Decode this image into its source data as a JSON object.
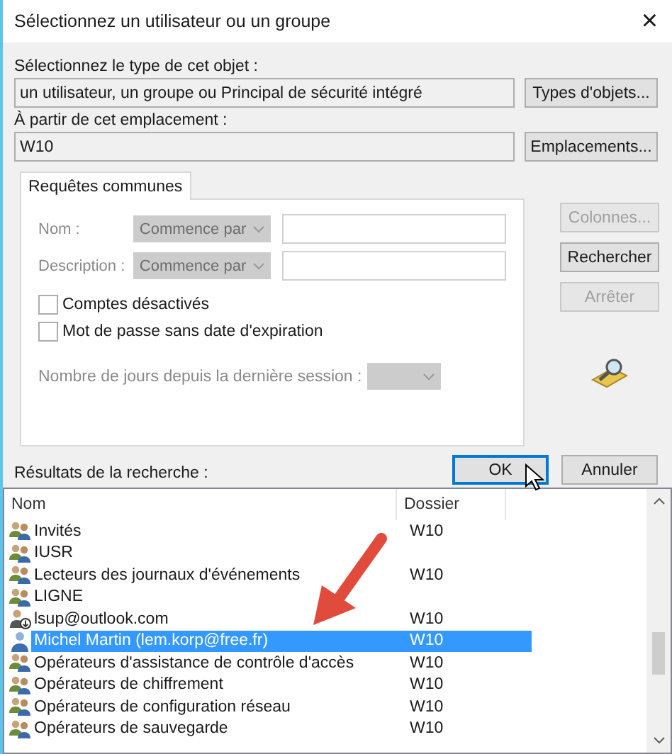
{
  "window": {
    "title": "Sélectionnez un utilisateur ou un groupe",
    "close": "×"
  },
  "object_type": {
    "label": "Sélectionnez le type de cet objet :",
    "value": "un utilisateur, un groupe ou Principal de sécurité intégré",
    "button": "Types d'objets..."
  },
  "location": {
    "label": "À partir de cet emplacement :",
    "value": "W10",
    "button": "Emplacements..."
  },
  "tabs": [
    {
      "label": "Requêtes communes",
      "selected": true
    }
  ],
  "query": {
    "fields": [
      {
        "label": "Nom :",
        "operator": "Commence par",
        "disabled": true
      },
      {
        "label": "Description :",
        "operator": "Commence par",
        "disabled": true
      }
    ],
    "checkboxes": [
      {
        "label": "Comptes désactivés",
        "checked": false
      },
      {
        "label": "Mot de passe sans date d'expiration",
        "checked": false
      }
    ],
    "days": {
      "label": "Nombre de jours depuis la dernière session :",
      "disabled": true
    }
  },
  "side_buttons": [
    {
      "label": "Colonnes...",
      "disabled": true
    },
    {
      "label": "Rechercher",
      "disabled": false
    },
    {
      "label": "Arrêter",
      "disabled": true
    }
  ],
  "dialog_buttons": [
    {
      "label": "OK",
      "default": true
    },
    {
      "label": "Annuler",
      "default": false
    }
  ],
  "results": {
    "label": "Résultats de la recherche :",
    "columns": [
      "Nom",
      "Dossier"
    ],
    "rows": [
      {
        "name": "Invités",
        "folder": "W10",
        "kind": "group",
        "selected": false
      },
      {
        "name": "IUSR",
        "kind": "group",
        "selected": false
      },
      {
        "name": "Lecteurs des journaux d'événements",
        "folder": "W10",
        "kind": "group",
        "selected": false
      },
      {
        "name": "LIGNE",
        "kind": "group",
        "selected": false
      },
      {
        "name": "lsup@outlook.com",
        "folder": "W10",
        "kind": "online",
        "selected": false
      },
      {
        "name": "Michel Martin (lem.korp@free.fr)",
        "folder": "W10",
        "kind": "user",
        "selected": true
      },
      {
        "name": "Opérateurs d'assistance de contrôle d'accès",
        "folder": "W10",
        "kind": "group",
        "selected": false
      },
      {
        "name": "Opérateurs de chiffrement",
        "folder": "W10",
        "kind": "group",
        "selected": false
      },
      {
        "name": "Opérateurs de configuration réseau",
        "folder": "W10",
        "kind": "group",
        "selected": false
      },
      {
        "name": "Opérateurs de sauvegarde",
        "folder": "W10",
        "kind": "group",
        "selected": false
      }
    ]
  }
}
